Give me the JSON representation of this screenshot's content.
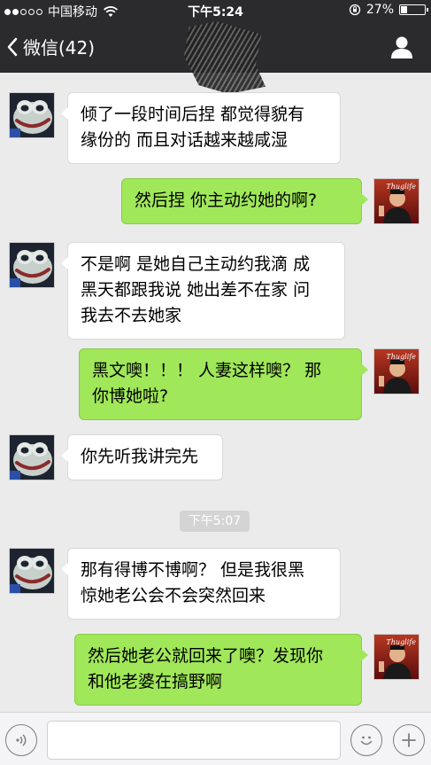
{
  "status_bar": {
    "carrier": "中国移动",
    "time": "下午5:24",
    "battery": "27%",
    "battery_level": 0.27
  },
  "nav": {
    "back_label": "微信(42)"
  },
  "messages": [
    {
      "side": "left",
      "lines": [
        "倾了一段时间后捏 都觉得貌有",
        "缘份的 而且对话越来越咸湿"
      ]
    },
    {
      "side": "right",
      "lines": [
        "然后捏  你主动约她的啊?"
      ]
    },
    {
      "side": "left",
      "lines": [
        "不是啊 是她自己主动约我滴 成",
        "黑天都跟我说 她出差不在家 问",
        "我去不去她家"
      ]
    },
    {
      "side": "right",
      "lines": [
        "黑文噢！！！  人妻这样噢？ 那",
        "你博她啦?"
      ]
    },
    {
      "side": "left",
      "lines": [
        "你先听我讲完先"
      ]
    },
    {
      "side": "left",
      "lines": [
        "那有得博不博啊？ 但是我很黑",
        "惊她老公会不会突然回来"
      ]
    },
    {
      "side": "right",
      "lines": [
        "然后她老公就回来了噢？发现你",
        "和他老婆在搞野啊"
      ]
    }
  ],
  "timestamp": "下午5:07",
  "avatar_right_text": "Thuglife",
  "colors": {
    "bar": "#2b2b2e",
    "background": "#ebebeb",
    "bubble_out": "#a0e759",
    "bubble_in": "#ffffff"
  },
  "icons": {
    "voice": "voice-icon",
    "emoji": "emoji-icon",
    "more": "plus-icon",
    "profile": "person-icon",
    "back": "chevron-left-icon"
  }
}
